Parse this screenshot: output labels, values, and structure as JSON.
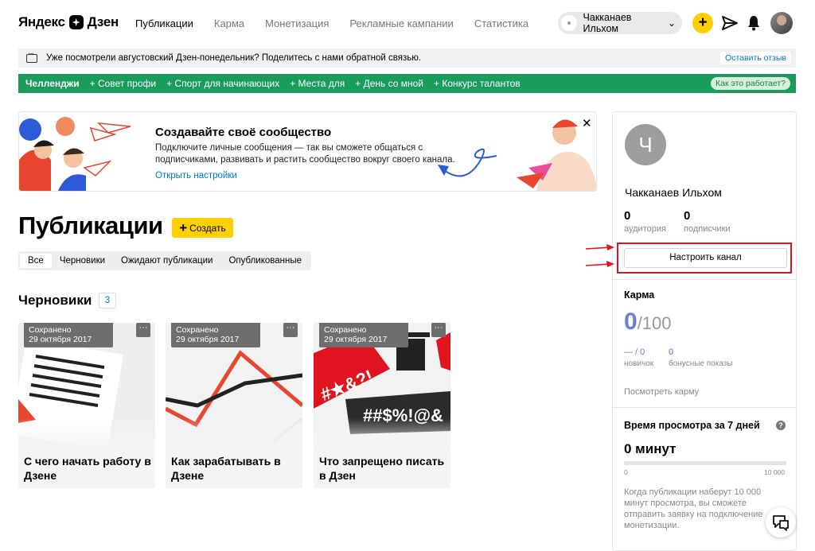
{
  "header": {
    "logo": "Яндекс",
    "logo_product": "Дзен",
    "nav": [
      "Публикации",
      "Карма",
      "Монетизация",
      "Рекламные кампании",
      "Статистика"
    ],
    "nav_active": 0,
    "user_name": "Чакканаев Ильхом",
    "plus_icon": "+",
    "chevron_icon": "⌄"
  },
  "feedback": {
    "text": "Уже посмотрели августовский Дзен-понедельник? Поделитесь с нами обратной связью.",
    "button": "Оставить отзыв"
  },
  "challenges": {
    "lead": "Челленджи",
    "items": [
      "+ Совет профи",
      "+ Спорт для начинающих",
      "+ Места для",
      "+ День со мной",
      "+ Конкурс талантов"
    ],
    "how": "Как это работает?"
  },
  "promo": {
    "title": "Создавайте своё сообщество",
    "text": "Подключите личные сообщения — так вы сможете общаться с подписчиками, развивать и растить сообщество вокруг своего канала.",
    "link": "Открыть настройки",
    "close": "✕"
  },
  "publications": {
    "title": "Публикации",
    "create_button": "Создать",
    "create_plus": "+",
    "tabs": [
      "Все",
      "Черновики",
      "Ожидают публикации",
      "Опубликованные"
    ],
    "active_tab": 0,
    "drafts_title": "Черновики",
    "drafts_count": "3",
    "cards": [
      {
        "status": "Сохранено",
        "date": "29 октября 2017",
        "title": "С чего начать работу в Дзене",
        "more": "···"
      },
      {
        "status": "Сохранено",
        "date": "29 октября 2017",
        "title": "Как зарабатывать в Дзене",
        "more": "···"
      },
      {
        "status": "Сохранено",
        "date": "29 октября 2017",
        "title": "Что запрещено писать в Дзен",
        "more": "···",
        "art_text_1": "#★&?!",
        "art_text_2": "##$%!@&"
      }
    ]
  },
  "profile": {
    "avatar_letter": "Ч",
    "name": "Чакканаев Ильхом",
    "audience_value": "0",
    "audience_label": "аудитория",
    "subscribers_value": "0",
    "subscribers_label": "подписчики",
    "setup_button": "Настроить канал"
  },
  "karma": {
    "title": "Карма",
    "value": "0",
    "max": "/100",
    "newbie_value": "— / 0",
    "newbie_label": "новичок",
    "bonus_value": "0",
    "bonus_label": "бонусные показы",
    "link": "Посмотреть карму"
  },
  "watch_time": {
    "title": "Время просмотра за 7 дней",
    "help": "?",
    "value": "0 минут",
    "progress": 0,
    "scale_min": "0",
    "scale_max": "10 000",
    "note": "Когда публикации наберут 10 000 минут просмотра, вы сможете отправить заявку на подключение монетизации."
  },
  "colors": {
    "accent_yellow": "#ffd000",
    "challenge_green": "#1a9c5c",
    "link_blue": "#0077cc",
    "karma_blue": "#6b7fd6",
    "highlight_red": "#e0141e"
  }
}
